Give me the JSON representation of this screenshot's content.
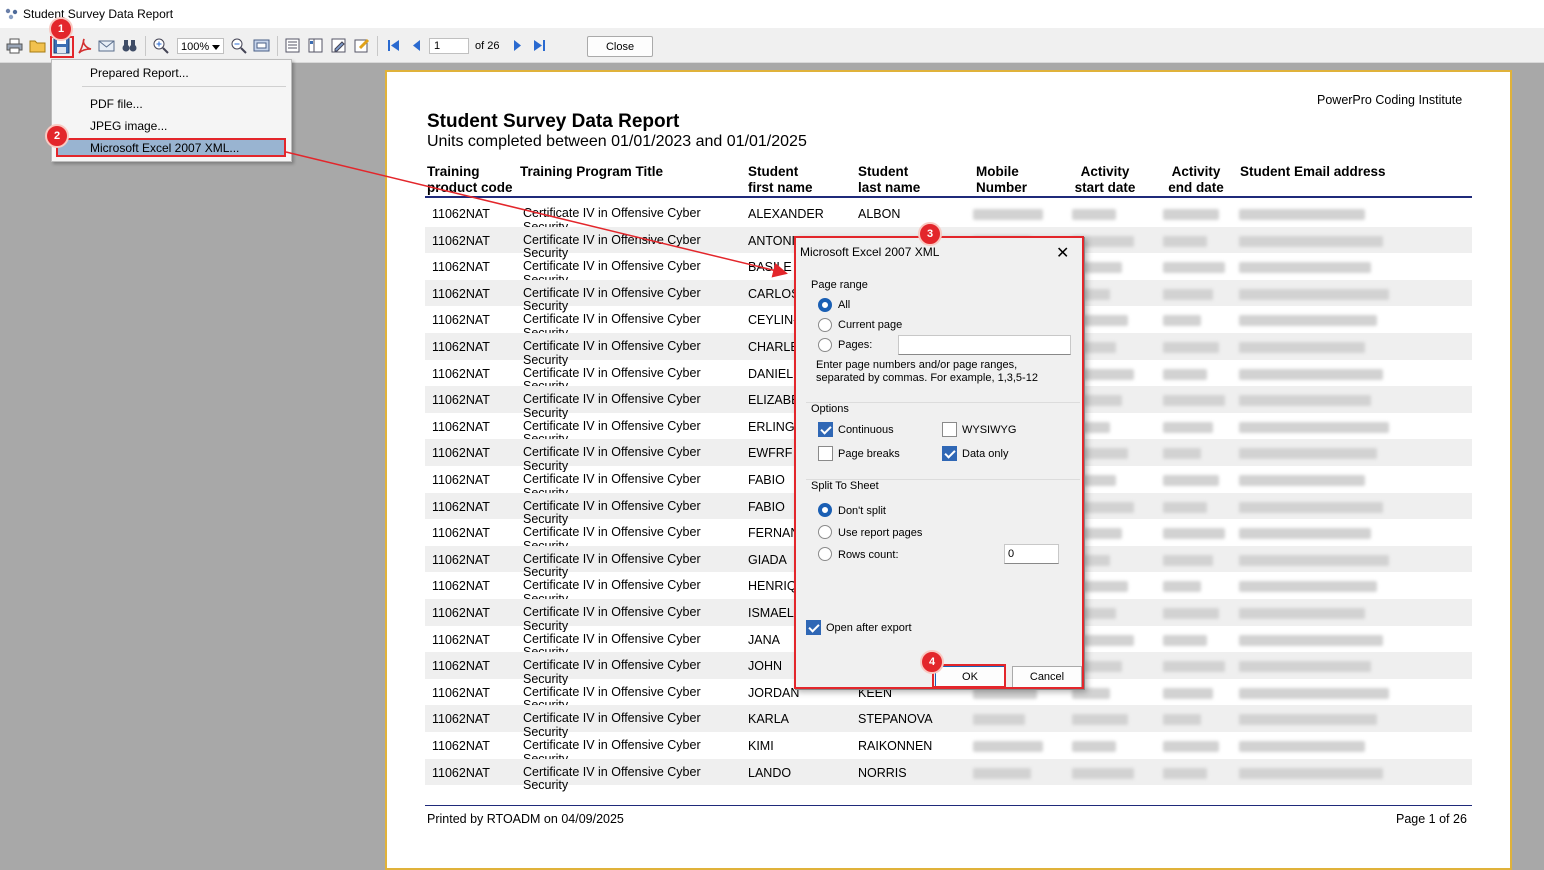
{
  "window": {
    "title": "Student Survey Data Report"
  },
  "toolbar": {
    "zoom": "100%",
    "page_input": "1",
    "page_of": "of 26",
    "close_label": "Close"
  },
  "save_menu": {
    "items": [
      {
        "label": "Prepared Report..."
      },
      {
        "label": "PDF file..."
      },
      {
        "label": "JPEG image..."
      },
      {
        "label": "Microsoft Excel 2007 XML..."
      }
    ]
  },
  "report": {
    "company": "PowerPro Coding Institute",
    "title": "Student Survey Data Report",
    "subtitle": "Units completed between 01/01/2023 and 01/01/2025",
    "columns": [
      "Training\nproduct code",
      "Training Program Title",
      "Student\nfirst name",
      "Student\nlast name",
      "Mobile\nNumber",
      "Activity\nstart date",
      "Activity\nend date",
      "Student Email address"
    ],
    "rows": [
      {
        "code": "11062NAT",
        "title": "Certificate IV in Offensive Cyber\nSecurity",
        "first": "ALEXANDER",
        "last": "ALBON"
      },
      {
        "code": "11062NAT",
        "title": "Certificate IV in Offensive Cyber\nSecurity",
        "first": "ANTONIO",
        "last": ""
      },
      {
        "code": "11062NAT",
        "title": "Certificate IV in Offensive Cyber\nSecurity",
        "first": "BASILE",
        "last": ""
      },
      {
        "code": "11062NAT",
        "title": "Certificate IV in Offensive Cyber\nSecurity",
        "first": "CARLOS",
        "last": ""
      },
      {
        "code": "11062NAT",
        "title": "Certificate IV in Offensive Cyber\nSecurity",
        "first": "CEYLIN-",
        "last": ""
      },
      {
        "code": "11062NAT",
        "title": "Certificate IV in Offensive Cyber\nSecurity",
        "first": "CHARLE",
        "last": ""
      },
      {
        "code": "11062NAT",
        "title": "Certificate IV in Offensive Cyber\nSecurity",
        "first": "DANIEL",
        "last": ""
      },
      {
        "code": "11062NAT",
        "title": "Certificate IV in Offensive Cyber\nSecurity",
        "first": "ELIZABE",
        "last": ""
      },
      {
        "code": "11062NAT",
        "title": "Certificate IV in Offensive Cyber\nSecurity",
        "first": "ERLING",
        "last": ""
      },
      {
        "code": "11062NAT",
        "title": "Certificate IV in Offensive Cyber\nSecurity",
        "first": "EWFRF",
        "last": ""
      },
      {
        "code": "11062NAT",
        "title": "Certificate IV in Offensive Cyber\nSecurity",
        "first": "FABIO",
        "last": ""
      },
      {
        "code": "11062NAT",
        "title": "Certificate IV in Offensive Cyber\nSecurity",
        "first": "FABIO",
        "last": ""
      },
      {
        "code": "11062NAT",
        "title": "Certificate IV in Offensive Cyber\nSecurity",
        "first": "FERNAN",
        "last": ""
      },
      {
        "code": "11062NAT",
        "title": "Certificate IV in Offensive Cyber\nSecurity",
        "first": "GIADA",
        "last": ""
      },
      {
        "code": "11062NAT",
        "title": "Certificate IV in Offensive Cyber\nSecurity",
        "first": "HENRIQ",
        "last": ""
      },
      {
        "code": "11062NAT",
        "title": "Certificate IV in Offensive Cyber\nSecurity",
        "first": "ISMAEL",
        "last": ""
      },
      {
        "code": "11062NAT",
        "title": "Certificate IV in Offensive Cyber\nSecurity",
        "first": "JANA",
        "last": ""
      },
      {
        "code": "11062NAT",
        "title": "Certificate IV in Offensive Cyber\nSecurity",
        "first": "JOHN",
        "last": ""
      },
      {
        "code": "11062NAT",
        "title": "Certificate IV in Offensive Cyber\nSecurity",
        "first": "JORDAN",
        "last": "KEEN"
      },
      {
        "code": "11062NAT",
        "title": "Certificate IV in Offensive Cyber\nSecurity",
        "first": "KARLA",
        "last": "STEPANOVA"
      },
      {
        "code": "11062NAT",
        "title": "Certificate IV in Offensive Cyber\nSecurity",
        "first": "KIMI",
        "last": "RAIKONNEN"
      },
      {
        "code": "11062NAT",
        "title": "Certificate IV in Offensive Cyber\nSecurity",
        "first": "LANDO",
        "last": "NORRIS"
      }
    ],
    "footer_left": "Printed by RTOADM on 04/09/2025",
    "footer_right": "Page 1 of 26"
  },
  "dialog": {
    "title": "Microsoft Excel 2007 XML",
    "page_range": {
      "label": "Page range",
      "all": "All",
      "current": "Current page",
      "pages": "Pages:",
      "pages_value": "",
      "hint": "Enter page numbers and/or page ranges,\nseparated by commas. For example, 1,3,5-12",
      "selected": "All"
    },
    "options": {
      "label": "Options",
      "continuous": "Continuous",
      "continuous_checked": true,
      "wysiwyg": "WYSIWYG",
      "wysiwyg_checked": false,
      "page_breaks": "Page breaks",
      "page_breaks_checked": false,
      "data_only": "Data only",
      "data_only_checked": true
    },
    "split": {
      "label": "Split To Sheet",
      "dont_split": "Don't split",
      "use_pages": "Use report pages",
      "rows_count": "Rows count:",
      "rows_value": "0",
      "selected": "Don't split"
    },
    "open_after": "Open after export",
    "open_after_checked": true,
    "ok": "OK",
    "cancel": "Cancel"
  },
  "annotations": {
    "badges": [
      "1",
      "2",
      "3",
      "4"
    ],
    "color": "#e3262b"
  },
  "colors": {
    "report_border": "#e0b23a",
    "header_rule": "#1f2a7a",
    "accent": "#1a5fb4"
  }
}
